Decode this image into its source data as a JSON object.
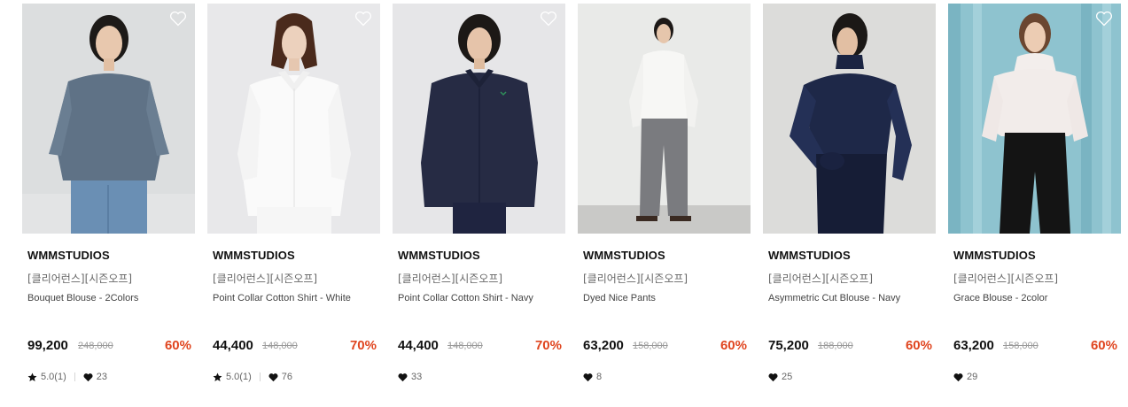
{
  "products": [
    {
      "brand": "WMMSTUDIOS",
      "tag": "[클리어런스][시즌오프]",
      "name": "Bouquet Blouse - 2Colors",
      "price": "99,200",
      "original_price": "248,000",
      "discount": "60%",
      "rating": "5.0(1)",
      "likes": "23",
      "has_rating": true
    },
    {
      "brand": "WMMSTUDIOS",
      "tag": "[클리어런스][시즌오프]",
      "name": "Point Collar Cotton Shirt - White",
      "price": "44,400",
      "original_price": "148,000",
      "discount": "70%",
      "rating": "5.0(1)",
      "likes": "76",
      "has_rating": true
    },
    {
      "brand": "WMMSTUDIOS",
      "tag": "[클리어런스][시즌오프]",
      "name": "Point Collar Cotton Shirt - Navy",
      "price": "44,400",
      "original_price": "148,000",
      "discount": "70%",
      "likes": "33",
      "has_rating": false
    },
    {
      "brand": "WMMSTUDIOS",
      "tag": "[클리어런스][시즌오프]",
      "name": "Dyed Nice Pants",
      "price": "63,200",
      "original_price": "158,000",
      "discount": "60%",
      "likes": "8",
      "has_rating": false
    },
    {
      "brand": "WMMSTUDIOS",
      "tag": "[클리어런스][시즌오프]",
      "name": "Asymmetric Cut Blouse - Navy",
      "price": "75,200",
      "original_price": "188,000",
      "discount": "60%",
      "likes": "25",
      "has_rating": false
    },
    {
      "brand": "WMMSTUDIOS",
      "tag": "[클리어런스][시즌오프]",
      "name": "Grace Blouse - 2color",
      "price": "63,200",
      "original_price": "158,000",
      "discount": "60%",
      "likes": "29",
      "has_rating": false
    }
  ],
  "colors": {
    "discount": "#e0451f",
    "text": "#111111",
    "muted": "#666666"
  },
  "icons": {
    "wishlist": "heart-outline-icon",
    "rating": "star-icon",
    "likes": "heart-icon"
  }
}
